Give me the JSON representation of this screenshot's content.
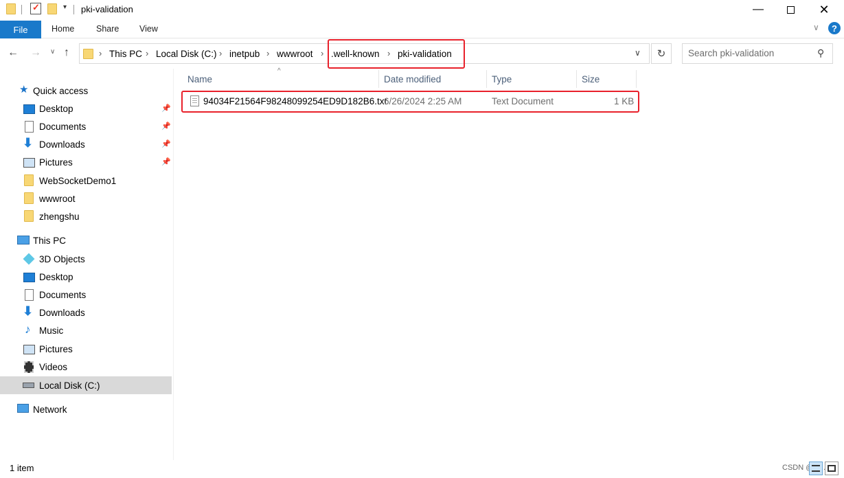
{
  "window": {
    "title": "pki-validation",
    "controls": [
      "minimize-icon",
      "maximize-icon",
      "close-icon"
    ]
  },
  "ribbon": {
    "tabs": [
      "File",
      "Home",
      "Share",
      "View"
    ]
  },
  "address": {
    "crumbs": [
      "This PC",
      "Local Disk (C:)",
      "inetpub",
      "wwwroot",
      ".well-known",
      "pki-validation"
    ]
  },
  "search": {
    "placeholder": "Search pki-validation"
  },
  "sidebar": {
    "quick_access": "Quick access",
    "quick_items": [
      {
        "label": "Desktop",
        "icon": "desktop-icon",
        "pinned": true
      },
      {
        "label": "Documents",
        "icon": "documents-icon",
        "pinned": true
      },
      {
        "label": "Downloads",
        "icon": "downloads-icon",
        "pinned": true
      },
      {
        "label": "Pictures",
        "icon": "pictures-icon",
        "pinned": true
      },
      {
        "label": "WebSocketDemo1",
        "icon": "folder-icon",
        "pinned": false
      },
      {
        "label": "wwwroot",
        "icon": "folder-icon",
        "pinned": false
      },
      {
        "label": "zhengshu",
        "icon": "folder-icon",
        "pinned": false
      }
    ],
    "this_pc": "This PC",
    "pc_items": [
      {
        "label": "3D Objects",
        "icon": "3d-objects-icon"
      },
      {
        "label": "Desktop",
        "icon": "desktop-icon"
      },
      {
        "label": "Documents",
        "icon": "documents-icon"
      },
      {
        "label": "Downloads",
        "icon": "downloads-icon"
      },
      {
        "label": "Music",
        "icon": "music-icon"
      },
      {
        "label": "Pictures",
        "icon": "pictures-icon"
      },
      {
        "label": "Videos",
        "icon": "videos-icon"
      },
      {
        "label": "Local Disk (C:)",
        "icon": "drive-icon",
        "selected": true
      }
    ],
    "network": "Network"
  },
  "files": {
    "columns": [
      "Name",
      "Date modified",
      "Type",
      "Size"
    ],
    "rows": [
      {
        "name": "94034F21564F98248099254ED9D182B6.txt",
        "date": "6/26/2024 2:25 AM",
        "type": "Text Document",
        "size": "1 KB"
      }
    ]
  },
  "status": {
    "count": "1 item",
    "watermark": "CSDN @di..."
  },
  "colors": {
    "accent": "#1979ca",
    "highlight": "#e8202a",
    "selected": "#d9d9d9"
  }
}
